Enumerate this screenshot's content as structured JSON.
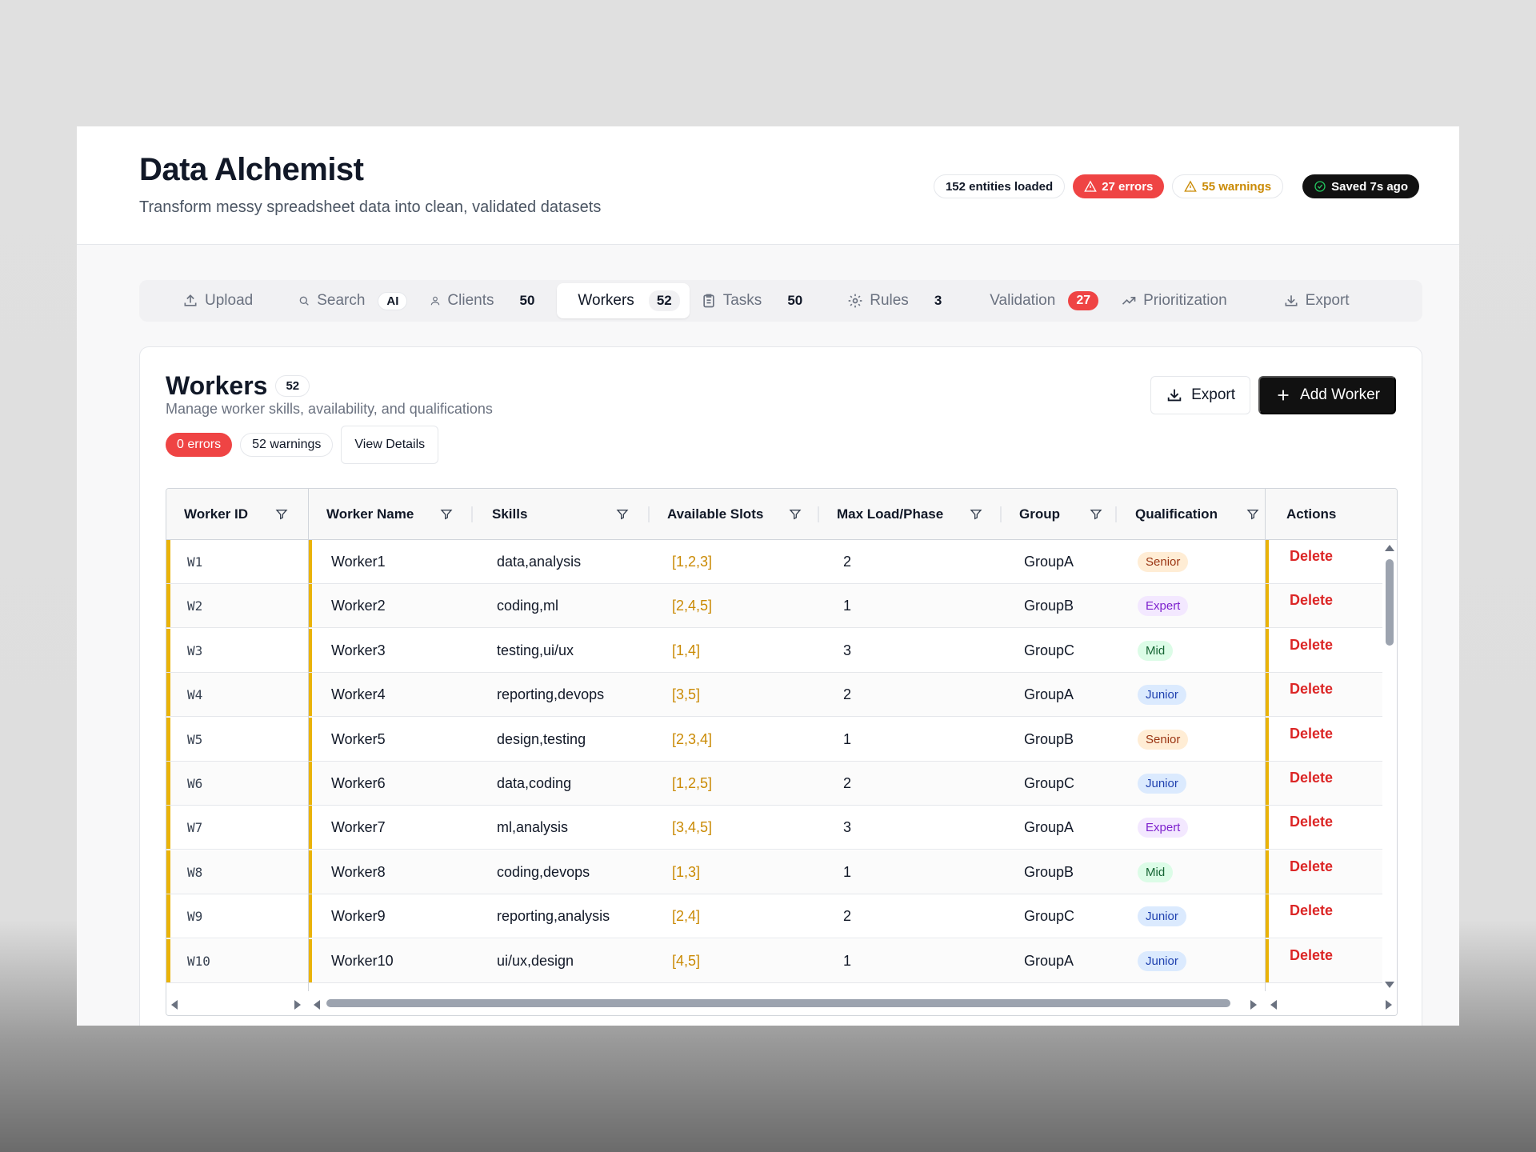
{
  "app": {
    "title": "Data Alchemist",
    "subtitle": "Transform messy spreadsheet data into clean, validated datasets"
  },
  "status": {
    "entities": "152 entities loaded",
    "errors": "27 errors",
    "warnings": "55 warnings",
    "saved": "Saved 7s ago"
  },
  "tabs": [
    {
      "label": "Upload",
      "icon": "upload-icon"
    },
    {
      "label": "Search",
      "badge": "AI",
      "icon": "search-icon"
    },
    {
      "label": "Clients",
      "count": "50",
      "icon": "users-icon"
    },
    {
      "label": "Workers",
      "count": "52",
      "active": true
    },
    {
      "label": "Tasks",
      "count": "50",
      "icon": "clipboard-icon"
    },
    {
      "label": "Rules",
      "count": "3",
      "icon": "gear-icon"
    },
    {
      "label": "Validation",
      "count": "27"
    },
    {
      "label": "Prioritization",
      "icon": "trending-icon"
    },
    {
      "label": "Export",
      "icon": "download-icon"
    }
  ],
  "card": {
    "title": "Workers",
    "count": "52",
    "subtitle": "Manage worker skills, availability, and qualifications",
    "errors": "0 errors",
    "warnings": "52 warnings",
    "view_details": "View Details",
    "export_label": "Export",
    "add_label": "Add Worker"
  },
  "table": {
    "columns": [
      "Worker ID",
      "Worker Name",
      "Skills",
      "Available Slots",
      "Max Load/Phase",
      "Group",
      "Qualification",
      "Actions"
    ],
    "delete_label": "Delete",
    "rows": [
      {
        "id": "W1",
        "name": "Worker1",
        "skills": "data,analysis",
        "slots": "[1,2,3]",
        "load": "2",
        "group": "GroupA",
        "qual": "Senior"
      },
      {
        "id": "W2",
        "name": "Worker2",
        "skills": "coding,ml",
        "slots": "[2,4,5]",
        "load": "1",
        "group": "GroupB",
        "qual": "Expert"
      },
      {
        "id": "W3",
        "name": "Worker3",
        "skills": "testing,ui/ux",
        "slots": "[1,4]",
        "load": "3",
        "group": "GroupC",
        "qual": "Mid"
      },
      {
        "id": "W4",
        "name": "Worker4",
        "skills": "reporting,devops",
        "slots": "[3,5]",
        "load": "2",
        "group": "GroupA",
        "qual": "Junior"
      },
      {
        "id": "W5",
        "name": "Worker5",
        "skills": "design,testing",
        "slots": "[2,3,4]",
        "load": "1",
        "group": "GroupB",
        "qual": "Senior"
      },
      {
        "id": "W6",
        "name": "Worker6",
        "skills": "data,coding",
        "slots": "[1,2,5]",
        "load": "2",
        "group": "GroupC",
        "qual": "Junior"
      },
      {
        "id": "W7",
        "name": "Worker7",
        "skills": "ml,analysis",
        "slots": "[3,4,5]",
        "load": "3",
        "group": "GroupA",
        "qual": "Expert"
      },
      {
        "id": "W8",
        "name": "Worker8",
        "skills": "coding,devops",
        "slots": "[1,3]",
        "load": "1",
        "group": "GroupB",
        "qual": "Mid"
      },
      {
        "id": "W9",
        "name": "Worker9",
        "skills": "reporting,analysis",
        "slots": "[2,4]",
        "load": "2",
        "group": "GroupC",
        "qual": "Junior"
      },
      {
        "id": "W10",
        "name": "Worker10",
        "skills": "ui/ux,design",
        "slots": "[4,5]",
        "load": "1",
        "group": "GroupA",
        "qual": "Junior"
      }
    ]
  }
}
